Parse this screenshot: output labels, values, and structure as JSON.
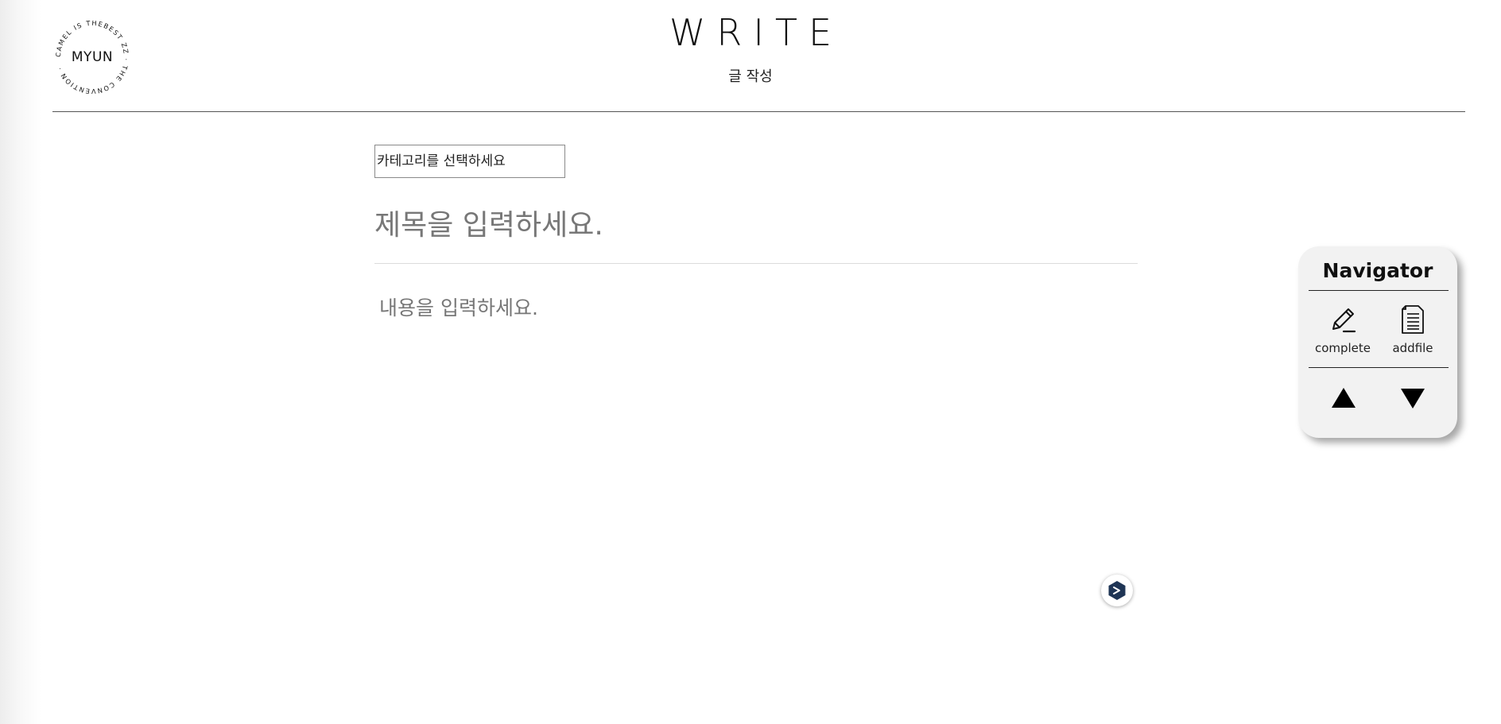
{
  "logo": {
    "center_text": "MYUN",
    "ring_text": "CAMEL IS THEBEST ZZ · THE CONVENTION ·"
  },
  "header": {
    "title": "WRITE",
    "subtitle": "글 작성"
  },
  "editor": {
    "category_placeholder": "카테고리를 선택하세요",
    "title_placeholder": "제목을 입력하세요.",
    "content_placeholder": "내용을 입력하세요."
  },
  "navigator": {
    "title": "Navigator",
    "buttons": [
      {
        "label": "complete",
        "icon": "pencil-icon"
      },
      {
        "label": "addfile",
        "icon": "document-icon"
      }
    ],
    "up_icon": "triangle-up-icon",
    "down_icon": "triangle-down-icon"
  },
  "floating_badge": {
    "icon": "hexagon-arrow-icon",
    "color": "#1f3555"
  },
  "colors": {
    "navigator_bg": "#f2f2f2",
    "placeholder_text": "#777777",
    "rule": "#555555"
  }
}
